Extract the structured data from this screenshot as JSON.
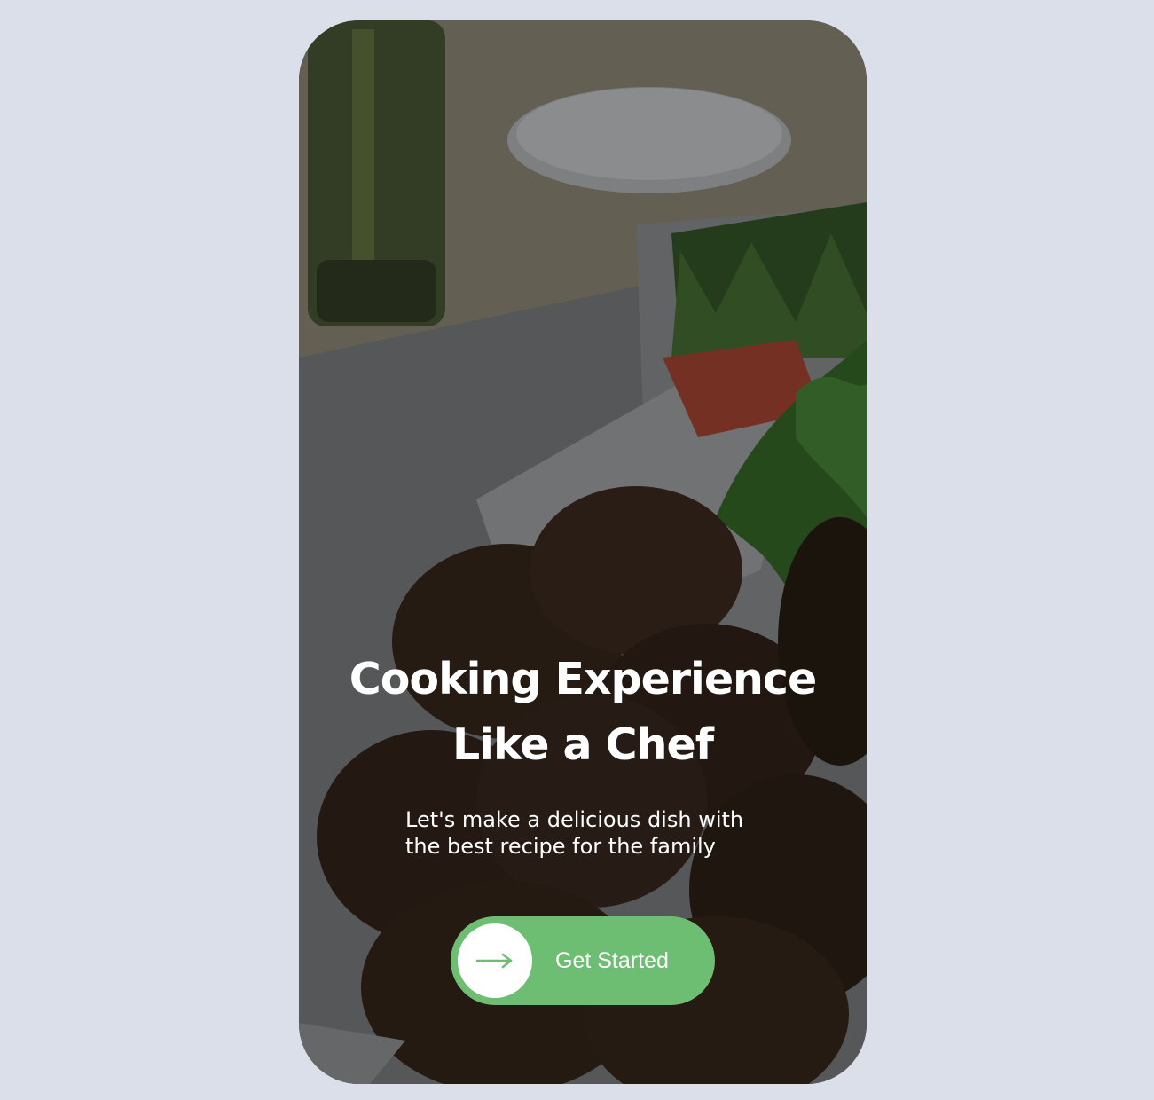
{
  "hero": {
    "image_description": "food-photo-falafel",
    "headline_line1": "Cooking Experience",
    "headline_line2": "Like a Chef",
    "subtitle_line1": "Let's make a delicious dish with",
    "subtitle_line2": "the best recipe for the family"
  },
  "cta": {
    "label": "Get Started",
    "icon": "arrow-right-icon"
  },
  "colors": {
    "page_background": "#dbdfea",
    "accent": "#6dbd72",
    "text": "#ffffff"
  }
}
